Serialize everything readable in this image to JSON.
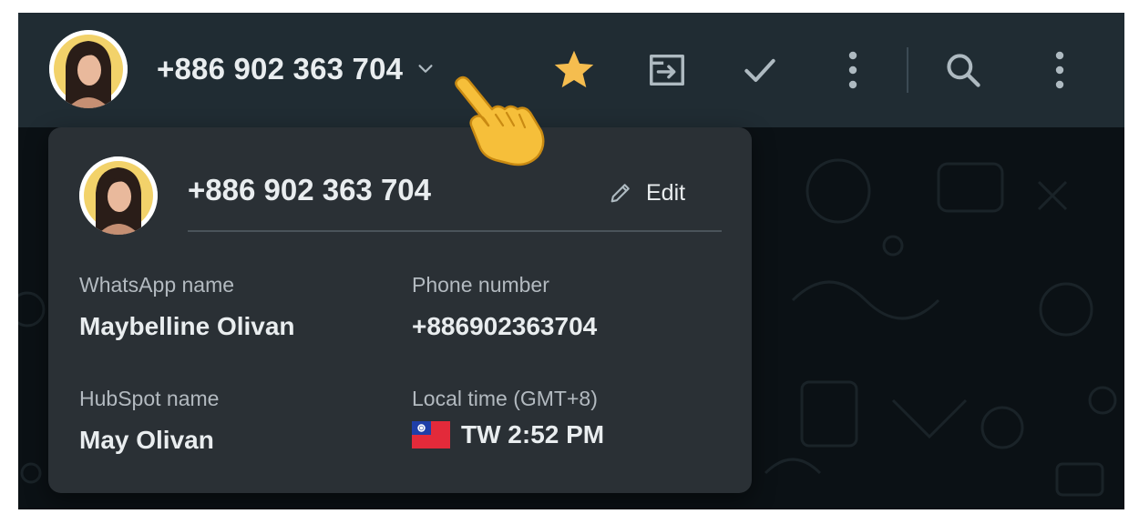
{
  "header": {
    "title": "+886 902 363 704",
    "icons": [
      "chevron-down-icon",
      "star-icon",
      "move-to-folder-icon",
      "check-icon",
      "more-vertical-icon",
      "search-icon",
      "more-vertical-icon"
    ]
  },
  "card": {
    "title": "+886 902 363 704",
    "edit_label": "Edit",
    "whatsapp_name_label": "WhatsApp name",
    "whatsapp_name_value": "Maybelline Olivan",
    "phone_label": "Phone number",
    "phone_value": "+886902363704",
    "hubspot_name_label": "HubSpot name",
    "hubspot_name_value": "May Olivan",
    "local_time_label": "Local time (GMT+8)",
    "local_time_value": "TW 2:52 PM"
  },
  "colors": {
    "header_bg": "#202c33",
    "card_bg": "#2a3035",
    "star": "#f5bd4f",
    "text_primary": "#e9edef",
    "text_secondary": "#b3bac0"
  }
}
